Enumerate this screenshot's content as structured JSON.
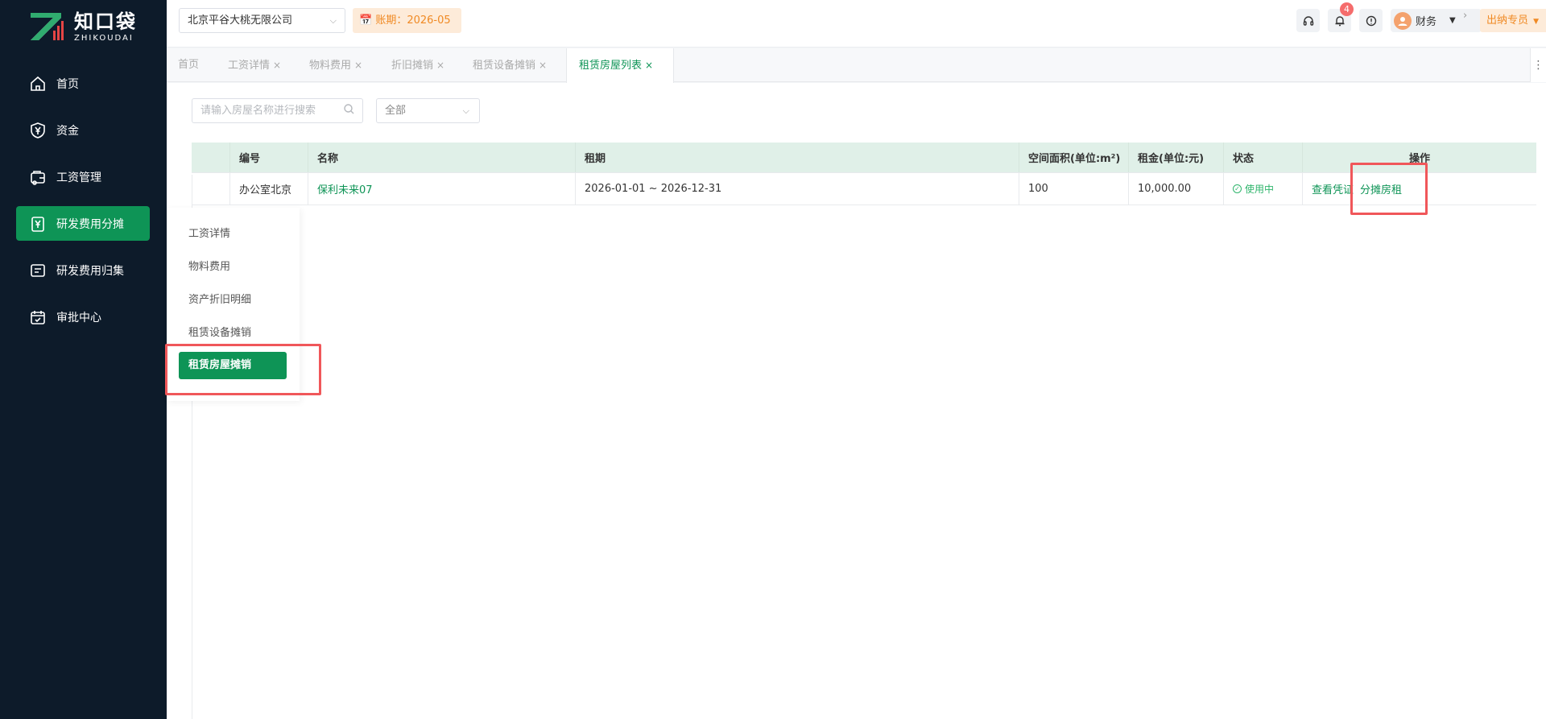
{
  "logo": {
    "cn": "知口袋",
    "en": "ZHIKOUDAI"
  },
  "sidebar": {
    "items": [
      {
        "label": "首页",
        "icon": "home-icon"
      },
      {
        "label": "资金",
        "icon": "yen-shield-icon"
      },
      {
        "label": "工资管理",
        "icon": "wallet-icon"
      },
      {
        "label": "研发费用分摊",
        "icon": "yen-doc-icon"
      },
      {
        "label": "研发费用归集",
        "icon": "list-doc-icon"
      },
      {
        "label": "审批中心",
        "icon": "calendar-check-icon"
      }
    ],
    "active_index": 3
  },
  "submenu": {
    "items": [
      "工资详情",
      "物料费用",
      "资产折旧明细",
      "租赁设备摊销",
      "租赁房屋摊销"
    ],
    "active_index": 4
  },
  "header": {
    "company": "北京平谷大桃无限公司",
    "period": "账期：2026-05",
    "notification_count": "4",
    "user_name": "财务",
    "role": "出纳专员"
  },
  "tabs": [
    {
      "label": "首页",
      "closable": false
    },
    {
      "label": "工资详情",
      "closable": true
    },
    {
      "label": "物料费用",
      "closable": true
    },
    {
      "label": "折旧摊销",
      "closable": true
    },
    {
      "label": "租赁设备摊销",
      "closable": true
    },
    {
      "label": "租赁房屋列表",
      "closable": true,
      "active": true
    }
  ],
  "filters": {
    "search_placeholder": "请输入房屋名称进行搜索",
    "status_value": "全部"
  },
  "table": {
    "columns": [
      "",
      "编号",
      "名称",
      "租期",
      "空间面积(单位:m²)",
      "租金(单位:元)",
      "状态",
      "操作"
    ],
    "rows": [
      {
        "code": "办公室北京",
        "name": "保利未来07",
        "period": "2026-01-01 ~ 2026-12-31",
        "area": "100",
        "rent": "10,000.00",
        "status": "使用中",
        "actions": [
          "查看凭证",
          "分摊房租"
        ]
      }
    ]
  },
  "colors": {
    "brand_green": "#0e9456",
    "sidebar_bg": "#0d1b2a",
    "highlight_red": "#f0575a",
    "header_row_bg": "#e0f0e8",
    "accent_orange": "#f08a24"
  }
}
